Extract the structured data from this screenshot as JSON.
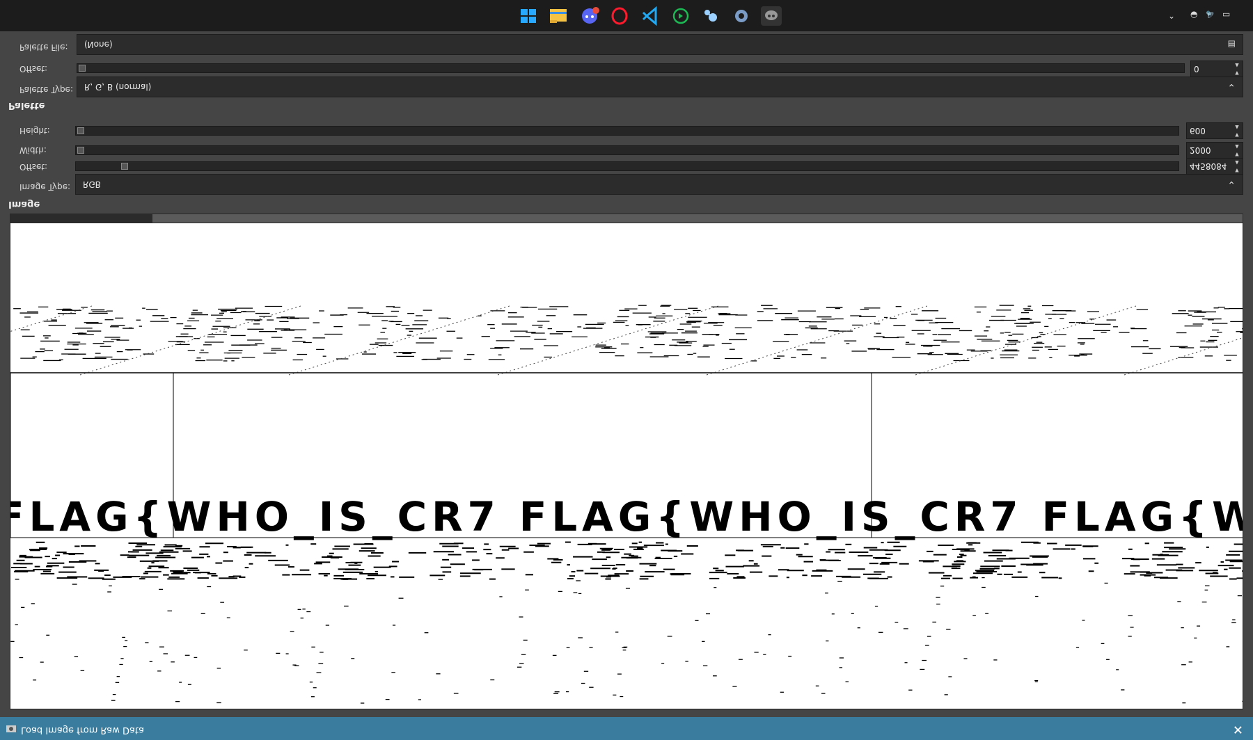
{
  "dialog": {
    "title": "Load Image from Raw Data",
    "close_icon": "close-icon",
    "title_icon": "app-icon"
  },
  "preview": {
    "banner_text": "FLAG{WHO_IS_CR7 FLAG{WHO_IS_CR7 FLAG{W"
  },
  "image_section": {
    "label": "Image",
    "image_type_label": "Image Type:",
    "image_type_value": "RGB",
    "offset_label": "Offset:",
    "offset_value": "4458084",
    "width_label": "Width:",
    "width_value": "2000",
    "height_label": "Height:",
    "height_value": "600"
  },
  "palette_section": {
    "label": "Palette",
    "palette_type_label": "Palette Type:",
    "palette_type_value": "R, G, B (normal)",
    "offset_label": "Offset:",
    "offset_value": "0",
    "palette_file_label": "Palette File:",
    "palette_file_value": "(None)"
  },
  "taskbar": {
    "icons": [
      "windows-start-icon",
      "file-explorer-icon",
      "discord-icon",
      "opera-icon",
      "vscode-icon",
      "refresh-app-icon",
      "steam-icon",
      "settings-icon",
      "gimp-icon"
    ],
    "tray_icons": [
      "chevron-up-icon",
      "network-icon",
      "volume-icon",
      "battery-icon"
    ]
  }
}
